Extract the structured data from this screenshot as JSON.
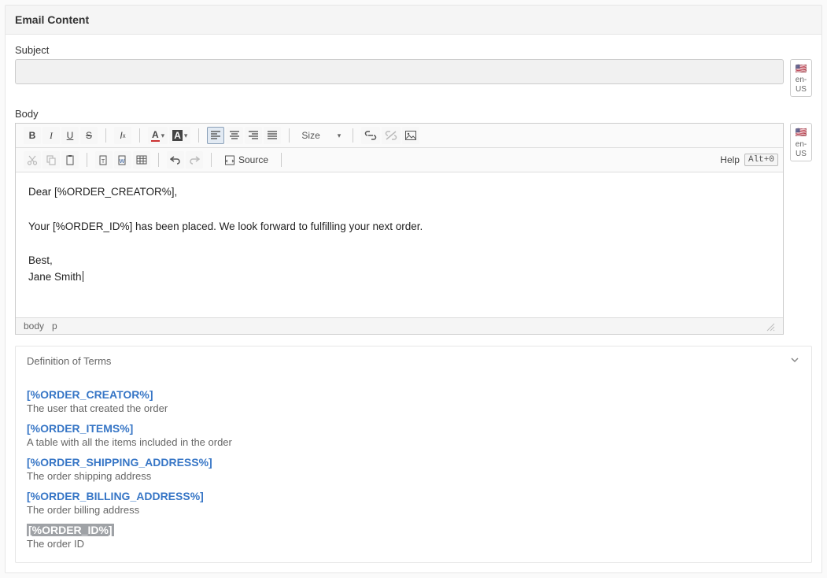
{
  "panel": {
    "title": "Email Content"
  },
  "subject": {
    "label": "Subject",
    "value": ""
  },
  "body": {
    "label": "Body"
  },
  "locale": {
    "code": "en-US",
    "flag": "🇺🇸"
  },
  "toolbar": {
    "size_label": "Size",
    "source_label": "Source",
    "help_label": "Help",
    "help_kbd": "Alt+0"
  },
  "editor": {
    "lines": [
      "Dear [%ORDER_CREATOR%],",
      "",
      "Your [%ORDER_ID%] has been placed. We look forward to fulfilling your next order.",
      "",
      "Best,",
      "Jane Smith"
    ],
    "status_path": [
      "body",
      "p"
    ]
  },
  "definitions": {
    "heading": "Definition of Terms",
    "terms": [
      {
        "name": "[%ORDER_CREATOR%]",
        "desc": "The user that created the order",
        "selected": false
      },
      {
        "name": "[%ORDER_ITEMS%]",
        "desc": "A table with all the items included in the order",
        "selected": false
      },
      {
        "name": "[%ORDER_SHIPPING_ADDRESS%]",
        "desc": "The order shipping address",
        "selected": false
      },
      {
        "name": "[%ORDER_BILLING_ADDRESS%]",
        "desc": "The order billing address",
        "selected": false
      },
      {
        "name": "[%ORDER_ID%]",
        "desc": "The order ID",
        "selected": true
      }
    ]
  }
}
